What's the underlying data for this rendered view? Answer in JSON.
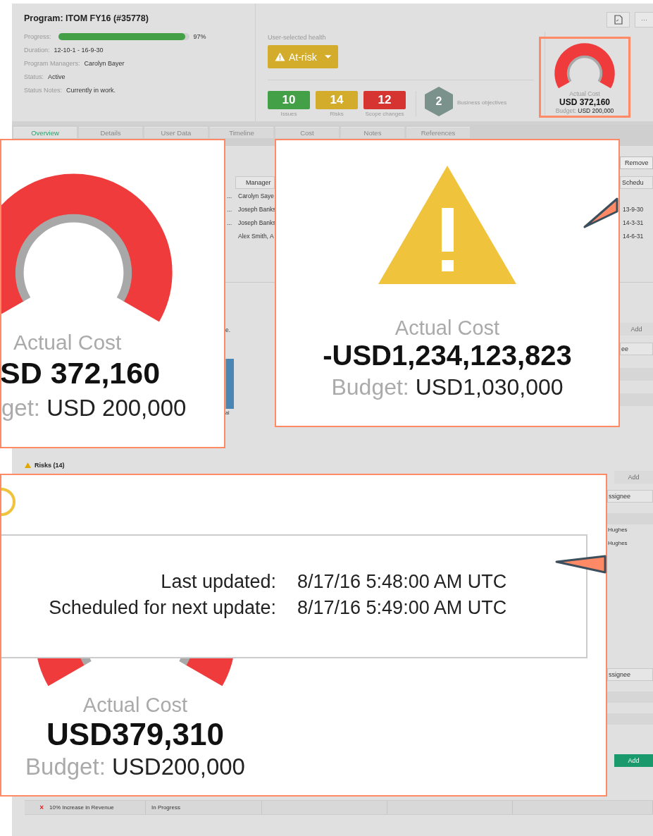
{
  "program": {
    "title": "Program: ITOM FY16 (#35778)",
    "progress": {
      "label": "Progress:",
      "level": 0.97,
      "reading": "97%"
    },
    "fields": [
      {
        "label": "Duration:",
        "value": "12-10-1 - 16-9-30"
      },
      {
        "label": "Program Managers:",
        "value": "Carolyn Bayer"
      },
      {
        "label": "Status:",
        "value": "Active"
      },
      {
        "label": "Status Notes:",
        "value": "Currently in work."
      }
    ]
  },
  "health": {
    "label": "User-selected health",
    "value": "At-risk"
  },
  "counts": [
    {
      "value": "10",
      "label": "Issues",
      "color": "#43a047"
    },
    {
      "value": "14",
      "label": "Risks",
      "color": "#d4ac2b"
    },
    {
      "value": "12",
      "label": "Scope changes",
      "color": "#d63431"
    }
  ],
  "objectives": {
    "value": "2",
    "label": "Business objectives"
  },
  "cost_summary": {
    "label": "Actual Cost",
    "value": "USD 372,160",
    "budget_label": "Budget:",
    "budget_value": "USD 200,000"
  },
  "header_buttons": [
    {
      "kind": "document"
    },
    {
      "kind": "more",
      "label": "···"
    }
  ],
  "tabs": [
    {
      "label": "Overview",
      "selected": true
    },
    {
      "label": "Details",
      "selected": false
    },
    {
      "label": "User Data",
      "selected": false
    },
    {
      "label": "Timeline",
      "selected": false
    },
    {
      "label": "Cost",
      "selected": false
    },
    {
      "label": "Notes",
      "selected": false
    },
    {
      "label": "References",
      "selected": false
    }
  ],
  "table": {
    "button": "Remove",
    "columns": [
      "Manager",
      "Schedu"
    ],
    "rows": [
      {
        "ref": "...",
        "manager": "Carolyn Saye"
      },
      {
        "ref": "...",
        "manager": "Joseph Banks",
        "schedule": "13-9-30"
      },
      {
        "ref": "...",
        "manager": "Joseph Banks",
        "schedule": "14-3-31"
      },
      {
        "manager": "Alex Smith, A",
        "schedule": "14-6-31"
      }
    ]
  },
  "chart_panel": {
    "note": "e.",
    "bar_label": "al"
  },
  "side_panel": {
    "add_button": {
      "label": "Add",
      "disabled": true
    },
    "column": "ee"
  },
  "risks": {
    "title": "Risks (14)",
    "add_button": {
      "label": "Add",
      "disabled": true
    },
    "column": "ssignee",
    "assignees": [
      "Hughes",
      "Hughes"
    ],
    "second_column": "ssignee",
    "second_add_button": {
      "label": "Add",
      "disabled": false
    }
  },
  "objective_rows": [
    {
      "mark": "×",
      "name": "10% Increase in Revenue",
      "state": "In Progress"
    }
  ],
  "callouts": [
    {
      "kind": "gauge",
      "label": "Actual Cost",
      "value": "SD 372,160",
      "budget_label": "get:",
      "budget_value": "USD 200,000"
    },
    {
      "kind": "warning",
      "label": "Actual Cost",
      "value": "-USD1,234,123,823",
      "budget_label": "Budget:",
      "budget_value": "USD1,030,000"
    },
    {
      "kind": "tooltip",
      "updates": [
        {
          "label": "Last updated:",
          "value": "8/17/16 5:48:00 AM UTC"
        },
        {
          "label": "Scheduled for next update:",
          "value": "8/17/16 5:49:00 AM UTC"
        }
      ],
      "label": "Actual Cost",
      "value": "USD379,310",
      "budget_label": "Budget:",
      "budget_value": "USD200,000"
    }
  ]
}
